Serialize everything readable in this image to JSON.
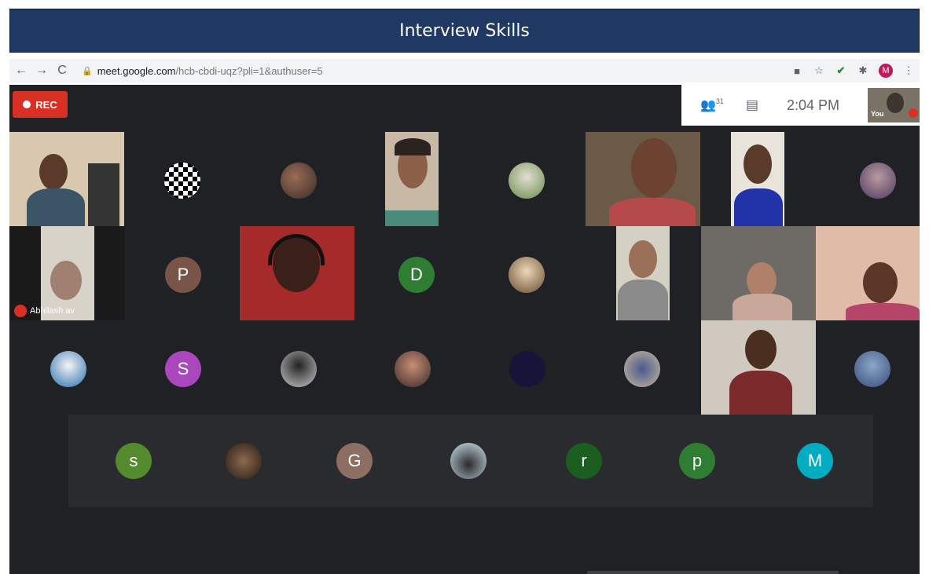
{
  "banner": {
    "title": "Interview Skills"
  },
  "browser": {
    "back": "←",
    "forward": "→",
    "reload": "C",
    "url_host": "meet.google.com",
    "url_path": "/hcb-cbdi-uqz?pli=1&authuser=5",
    "profile_initial": "M"
  },
  "meet": {
    "rec_label": "REC",
    "participant_count": "31",
    "time": "2:04 PM",
    "self_label": "You",
    "muted_name": "Abhilash av"
  },
  "avatars": {
    "p1": "P",
    "d1": "D",
    "s_purple": "S",
    "s_green": "s",
    "g1": "G",
    "r1": "r",
    "p2": "p",
    "m1": "M"
  },
  "colors": {
    "banner": "#1f3864",
    "meet_bg": "#202124",
    "rec": "#d93025",
    "av_p": "#795548",
    "av_d": "#2e7d32",
    "av_s_purple": "#ab47bc",
    "av_s_green": "#558b2f",
    "av_g": "#8d6e63",
    "av_r": "#1b5e20",
    "av_p2": "#2e7d32",
    "av_m": "#00acc1"
  }
}
